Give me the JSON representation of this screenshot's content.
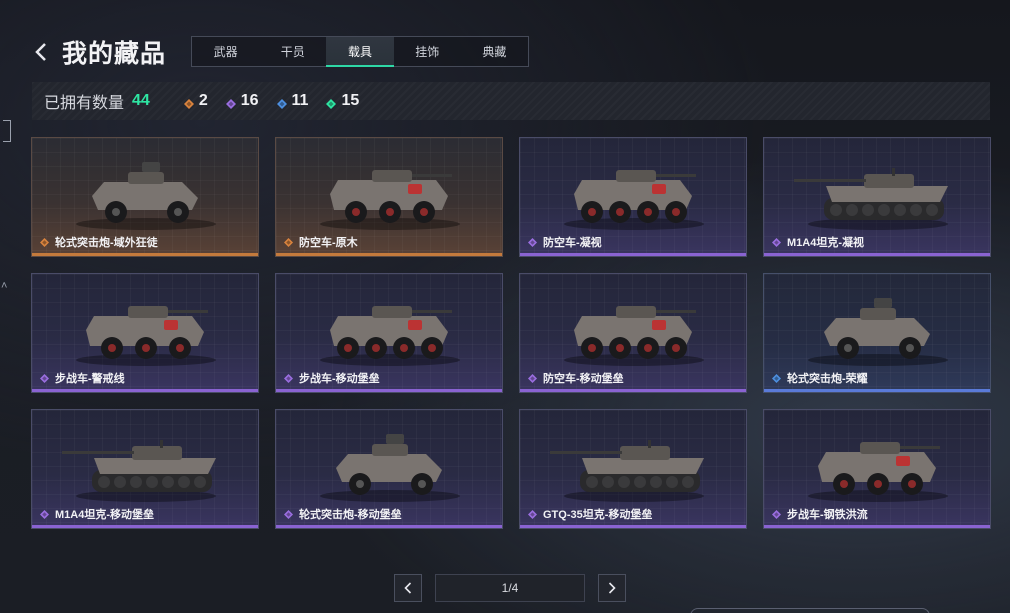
{
  "header": {
    "title": "我的藏品"
  },
  "tabs": [
    {
      "label": "武器",
      "active": false
    },
    {
      "label": "干员",
      "active": false
    },
    {
      "label": "载具",
      "active": true
    },
    {
      "label": "挂饰",
      "active": false
    },
    {
      "label": "典藏",
      "active": false
    }
  ],
  "stats": {
    "label": "已拥有数量",
    "total": "44",
    "counts": [
      {
        "icon": "orange-gem-icon",
        "value": "2",
        "color": "#d9833e"
      },
      {
        "icon": "purple-gem-icon",
        "value": "16",
        "color": "#9a6ee0"
      },
      {
        "icon": "blue-gem-icon",
        "value": "11",
        "color": "#4d8fe0"
      },
      {
        "icon": "green-gem-icon",
        "value": "15",
        "color": "#2ee6a3"
      }
    ]
  },
  "cards": [
    {
      "name": "轮式突击炮-域外狂徒",
      "rarity": "orange",
      "vehicle": "wheeled-4"
    },
    {
      "name": "防空车-原木",
      "rarity": "orange",
      "vehicle": "apc-6"
    },
    {
      "name": "防空车-凝视",
      "rarity": "purple",
      "vehicle": "apc-8"
    },
    {
      "name": "M1A4坦克-凝视",
      "rarity": "purple",
      "vehicle": "tank"
    },
    {
      "name": "步战车-警戒线",
      "rarity": "purple",
      "vehicle": "apc-6"
    },
    {
      "name": "步战车-移动堡垒",
      "rarity": "purple",
      "vehicle": "apc-8"
    },
    {
      "name": "防空车-移动堡垒",
      "rarity": "purple",
      "vehicle": "apc-8"
    },
    {
      "name": "轮式突击炮-荣耀",
      "rarity": "blue",
      "vehicle": "wheeled-4"
    },
    {
      "name": "M1A4坦克-移动堡垒",
      "rarity": "purple",
      "vehicle": "tank"
    },
    {
      "name": "轮式突击炮-移动堡垒",
      "rarity": "purple",
      "vehicle": "wheeled-4"
    },
    {
      "name": "GTQ-35坦克-移动堡垒",
      "rarity": "purple",
      "vehicle": "tank"
    },
    {
      "name": "步战车-钢铁洪流",
      "rarity": "purple",
      "vehicle": "apc-6"
    }
  ],
  "pager": {
    "label": "1/4"
  },
  "colors": {
    "accent": "#2ee6a3",
    "orange": "#d9833e",
    "purple": "#9a6ee0",
    "blue": "#4d8fe0"
  }
}
